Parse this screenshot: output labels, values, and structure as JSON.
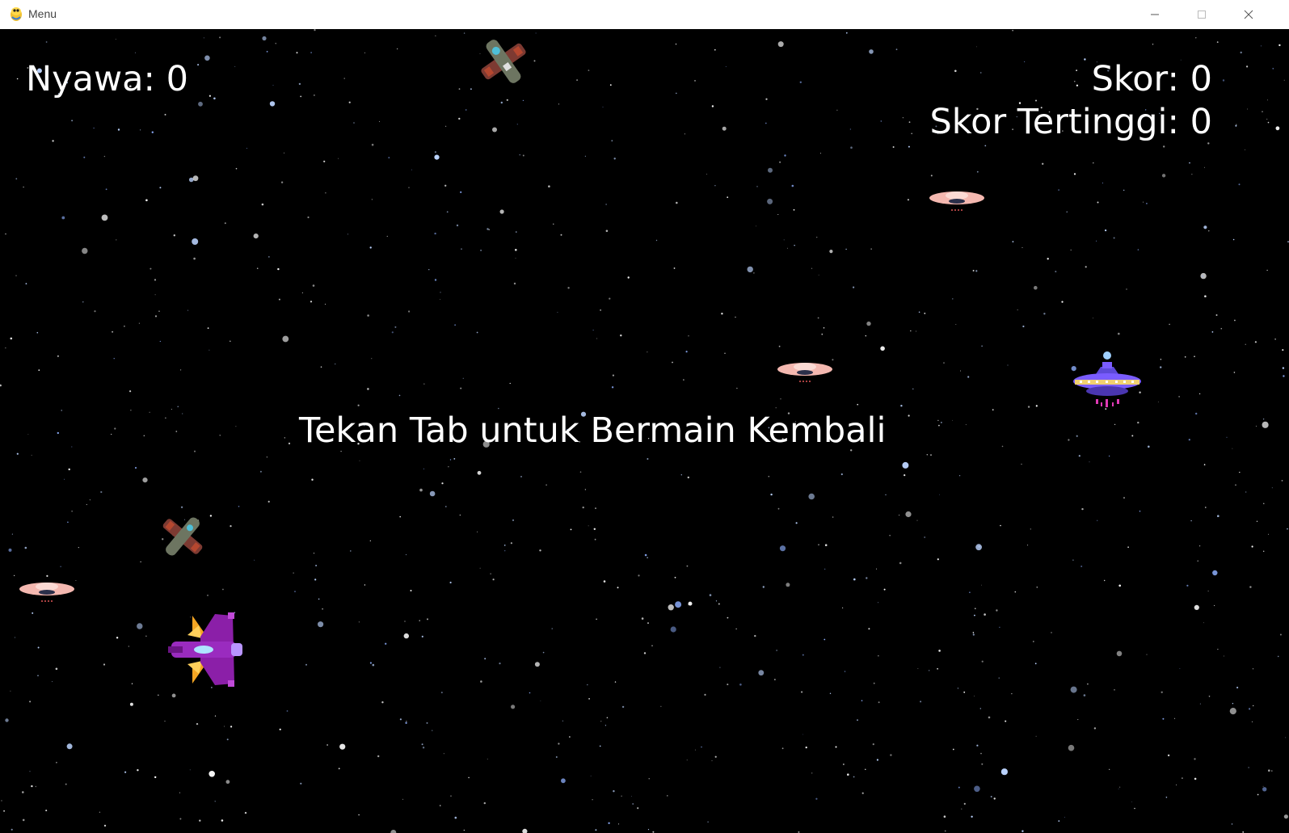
{
  "window": {
    "title": "Menu",
    "icon": "pygame-snake-icon",
    "controls": [
      "minimize-icon",
      "maximize-icon",
      "close-icon"
    ]
  },
  "hud": {
    "lives_label": "Nyawa: 0",
    "score_label": "Skor: 0",
    "high_score_label": "Skor Tertinggi: 0"
  },
  "message": {
    "text": "Tekan Tab untuk Bermain Kembali"
  },
  "colors": {
    "background": "#000000",
    "text": "#ffffff",
    "ufo_pink": "#f4b8b0",
    "ufo_purple": "#7a5cff",
    "player_ship": "#8b1fa8"
  },
  "sprites": [
    {
      "name": "enemy-plane-sprite",
      "kind": "enemy-plane"
    },
    {
      "name": "enemy-plane-sprite",
      "kind": "enemy-plane"
    },
    {
      "name": "pink-ufo-sprite",
      "kind": "ufo-small"
    },
    {
      "name": "pink-ufo-sprite",
      "kind": "ufo-small"
    },
    {
      "name": "pink-ufo-sprite",
      "kind": "ufo-small"
    },
    {
      "name": "purple-ufo-sprite",
      "kind": "ufo-big"
    },
    {
      "name": "player-ship-sprite",
      "kind": "player"
    }
  ]
}
